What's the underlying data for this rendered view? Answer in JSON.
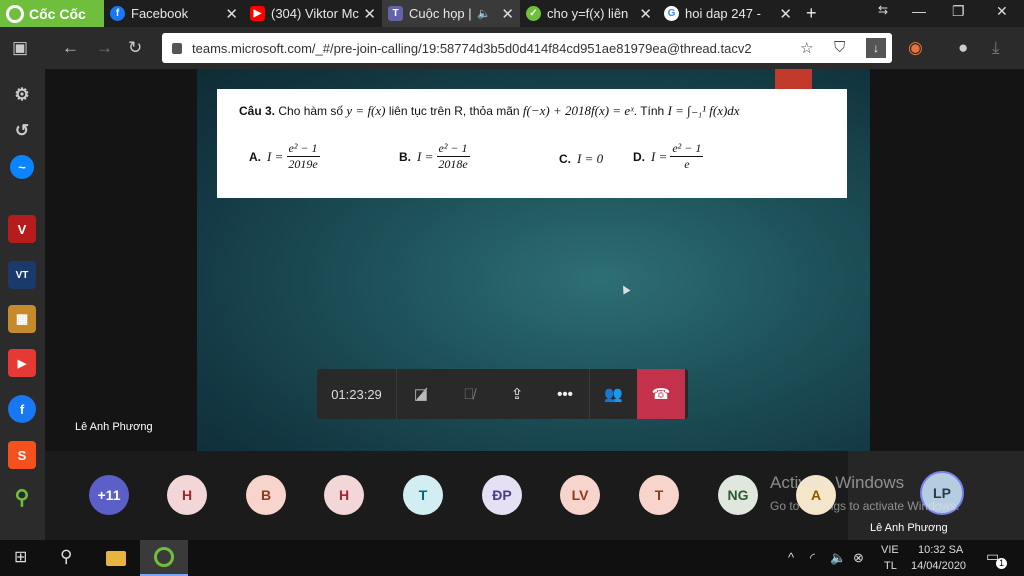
{
  "browser": {
    "brand": "Cốc Cốc",
    "tabs": [
      {
        "label": "Facebook",
        "icon": "facebook-icon",
        "color": "#1877f2"
      },
      {
        "label": "(304) Viktor Mc",
        "icon": "youtube-icon",
        "color": "#ff0000"
      },
      {
        "label": "Cuộc họp |",
        "icon": "teams-icon",
        "color": "#6264a7"
      },
      {
        "label": "cho y=f(x) liên",
        "icon": "hoidap-icon",
        "color": "#6fbf3c"
      },
      {
        "label": "hoi dap 247 -",
        "icon": "google-icon",
        "color": "#4285f4"
      }
    ],
    "url": "teams.microsoft.com/_#/pre-join-calling/19:58774d3b5d0d414f84cd951ae81979ea@thread.tacv2"
  },
  "sidebar": {
    "items": [
      {
        "name": "sidebar-item-v",
        "text": "V",
        "color": "#b71c1c"
      },
      {
        "name": "sidebar-item-vt",
        "text": "VT",
        "color": "#1a3a6b"
      },
      {
        "name": "sidebar-item-app",
        "text": "▦",
        "color": "#c68a2c"
      },
      {
        "name": "sidebar-item-youtube",
        "text": "▶",
        "color": "#e53935"
      },
      {
        "name": "sidebar-item-facebook",
        "text": "f",
        "color": "#1877f2"
      },
      {
        "name": "sidebar-item-shopee",
        "text": "S",
        "color": "#f4511e"
      }
    ]
  },
  "document": {
    "question_label": "Câu 3.",
    "question_text": "Cho hàm số",
    "question_func": "y = f(x)",
    "question_mid": "liên tục trên R, thỏa mãn",
    "question_eq": "f(−x) + 2018f(x) = eˣ",
    "question_end": ". Tính",
    "question_integral": "I = ∫₋₁¹ f(x)dx",
    "answers": [
      {
        "label": "A.",
        "lhs": "I =",
        "num": "e² − 1",
        "den": "2019e"
      },
      {
        "label": "B.",
        "lhs": "I =",
        "num": "e² − 1",
        "den": "2018e"
      },
      {
        "label": "C.",
        "lhs": "I = 0",
        "num": "",
        "den": ""
      },
      {
        "label": "D.",
        "lhs": "I =",
        "num": "e² − 1",
        "den": "e"
      }
    ]
  },
  "meeting": {
    "presenter": "Lê Anh Phương",
    "timer": "01:23:29"
  },
  "participants": [
    {
      "initials": "+11",
      "bg": "#5b5fc7",
      "fg": "#ffffff"
    },
    {
      "initials": "H",
      "bg": "#f3d6d8",
      "fg": "#a4262c"
    },
    {
      "initials": "B",
      "bg": "#f8d5cc",
      "fg": "#8e3a1e"
    },
    {
      "initials": "H",
      "bg": "#f3d6d8",
      "fg": "#a4262c"
    },
    {
      "initials": "T",
      "bg": "#d3eef2",
      "fg": "#006a75"
    },
    {
      "initials": "ĐP",
      "bg": "#e6e0f4",
      "fg": "#4f3a8e"
    },
    {
      "initials": "LV",
      "bg": "#f8d5cc",
      "fg": "#8e3a1e"
    },
    {
      "initials": "T",
      "bg": "#f8d5cc",
      "fg": "#8e3a1e"
    },
    {
      "initials": "NG",
      "bg": "#dfe7df",
      "fg": "#2f5a2f"
    },
    {
      "initials": "A",
      "bg": "#f6e6c8",
      "fg": "#8a5a00"
    }
  ],
  "self": {
    "initials": "LP",
    "name": "Lê Anh Phương"
  },
  "watermark": {
    "line1": "Activate Windows",
    "line2": "Go to Settings to activate Windows."
  },
  "taskbar": {
    "lang_top": "VIE",
    "lang_bottom": "TL",
    "time": "10:32 SA",
    "date": "14/04/2020",
    "notif_count": "1"
  }
}
